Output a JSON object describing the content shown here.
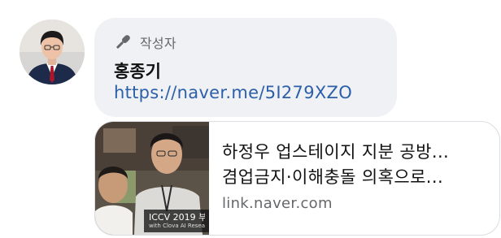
{
  "comment": {
    "author_tag": "작성자",
    "author_name": "홍종기",
    "link_text": "https://naver.me/5I279XZO",
    "icons": {
      "author_badge": "microphone-icon"
    }
  },
  "link_preview": {
    "title_line1": "하정우 업스테이지 지분 공방...",
    "title_line2": "겸업금지·이해충돌 의혹으로...",
    "domain": "link.naver.com",
    "thumbnail_caption_line1": "ICCV 2019 부",
    "thumbnail_caption_line2": "with Clova AI Research"
  },
  "colors": {
    "bubble_bg": "#eff1f4",
    "link": "#2c5fa8",
    "secondary_text": "#65676b",
    "card_border": "#dadde1"
  }
}
